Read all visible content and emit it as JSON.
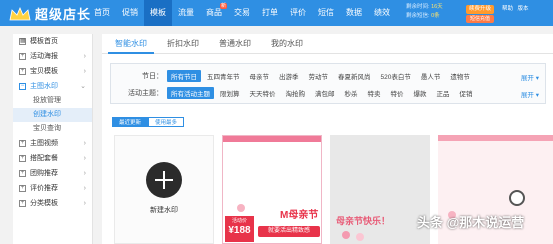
{
  "app": {
    "title": "超级店长"
  },
  "nav": [
    "首页",
    "促销",
    "模板",
    "流量",
    "商品",
    "交易",
    "打单",
    "评价",
    "短信",
    "数据",
    "绩效"
  ],
  "nav_badge": "新",
  "account": {
    "days_left_label": "剩余时间:",
    "days_left_value": "16天",
    "sms_left_label": "剩余短信:",
    "sms_left_value": "0条",
    "renew_button": "续费升级",
    "sms_button": "短信充值",
    "links": [
      "帮助",
      "版本"
    ]
  },
  "sidebar": {
    "items": [
      {
        "label": "模板首页",
        "expanded": false
      },
      {
        "label": "活动海报",
        "expanded": false
      },
      {
        "label": "宝贝模板",
        "expanded": false
      },
      {
        "label": "主图水印",
        "expanded": true
      },
      {
        "label": "主图视频",
        "expanded": false
      },
      {
        "label": "搭配套餐",
        "expanded": false
      },
      {
        "label": "团购推荐",
        "expanded": false
      },
      {
        "label": "评价推荐",
        "expanded": false
      },
      {
        "label": "分类模板",
        "expanded": false
      }
    ],
    "sub_items": [
      "投放管理",
      "创建水印",
      "宝贝查询"
    ]
  },
  "tabs": [
    "智能水印",
    "折扣水印",
    "普通水印",
    "我的水印"
  ],
  "filter": {
    "festival_label": "节日：",
    "festival_options": [
      "所有节日",
      "五四青年节",
      "母亲节",
      "出游季",
      "劳动节",
      "春夏新风尚",
      "520表白节",
      "愚人节",
      "遗物节"
    ],
    "theme_label": "活动主题：",
    "theme_options": [
      "所有活动主题",
      "限划算",
      "天天特价",
      "淘抢购",
      "满包邮",
      "秒杀",
      "特卖",
      "特价",
      "爆款",
      "正品",
      "促销"
    ],
    "expand_label": "展开 ▾"
  },
  "sort": [
    "最近更新",
    "使用最多"
  ],
  "cards": {
    "new_label": "新建水印",
    "pink_tag_top": "活动价",
    "pink_tag_num": "¥188",
    "pink_title": "M母亲节",
    "pink_slogan": "就要活出精致感",
    "gray_slogan": "母亲节快乐！"
  },
  "watermark": "头条 @那木说运营",
  "colors": {
    "brand": "#2f8fe3",
    "accent": "#e8334a"
  }
}
